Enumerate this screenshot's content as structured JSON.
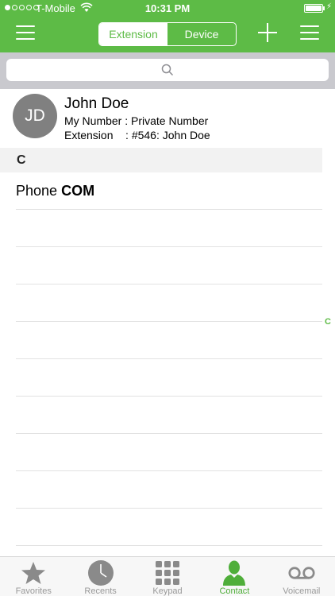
{
  "status_bar": {
    "carrier": "T-Mobile",
    "time": "10:31 PM",
    "battery_level": 1.0
  },
  "colors": {
    "accent": "#5dbb46",
    "tab_active": "#4fae3a",
    "tab_inactive": "#999999",
    "avatar_bg": "#808080"
  },
  "nav": {
    "segments": [
      {
        "label": "Extension",
        "active": true
      },
      {
        "label": "Device",
        "active": false
      }
    ],
    "icons": [
      "menu-icon",
      "plus-icon",
      "menu-icon"
    ]
  },
  "search": {
    "placeholder": "",
    "icon": "search-icon"
  },
  "my_card": {
    "initials": "JD",
    "name": "John Doe",
    "number_line": "My Number : Private Number",
    "extension_line": "Extension    : #546: John Doe"
  },
  "sections": [
    {
      "letter": "C",
      "contacts": [
        {
          "first": "Phone",
          "last": "COM"
        }
      ]
    }
  ],
  "index_letters": [
    "C"
  ],
  "tabbar": {
    "tabs": [
      {
        "label": "Favorites",
        "icon": "star-icon",
        "active": false
      },
      {
        "label": "Recents",
        "icon": "clock-icon",
        "active": false
      },
      {
        "label": "Keypad",
        "icon": "keypad-icon",
        "active": false
      },
      {
        "label": "Contact",
        "icon": "person-icon",
        "active": true
      },
      {
        "label": "Voicemail",
        "icon": "voicemail-icon",
        "active": false
      }
    ]
  }
}
